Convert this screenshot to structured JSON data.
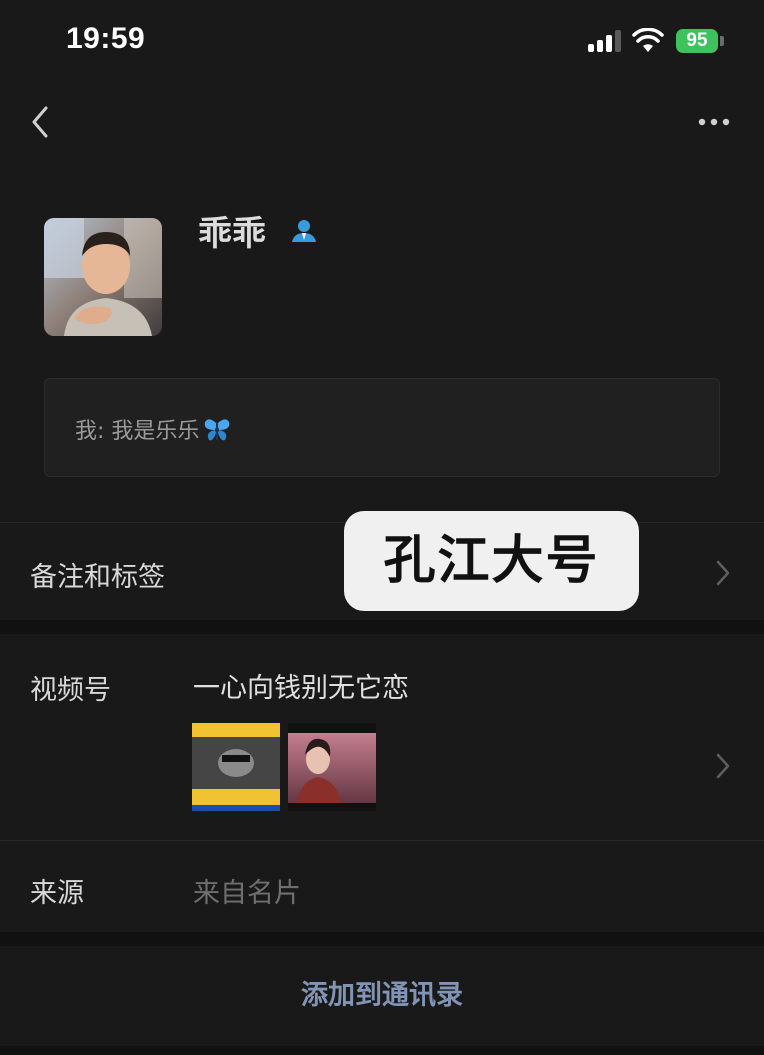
{
  "status_bar": {
    "time": "19:59",
    "battery": "95"
  },
  "icons": {
    "back": "chevron-left-icon",
    "more": "ellipsis-icon",
    "profile_badge": "person-icon",
    "butterfly": "butterfly-emoji-icon",
    "chevron": "chevron-right-icon"
  },
  "profile": {
    "name": "乖乖"
  },
  "greeting": {
    "text": "我: 我是乐乐"
  },
  "remark_row": {
    "label": "备注和标签"
  },
  "overlay": {
    "text": "孔江大号"
  },
  "channels_row": {
    "label": "视频号",
    "channel_name": "一心向钱别无它恋"
  },
  "source_row": {
    "label": "来源",
    "value": "来自名片"
  },
  "actions": {
    "add_contact": "添加到通讯录"
  },
  "colors": {
    "background": "#191919",
    "accent_link": "#8194b5",
    "battery_green": "#3ec25e",
    "badge_blue": "#3a9bdc"
  }
}
